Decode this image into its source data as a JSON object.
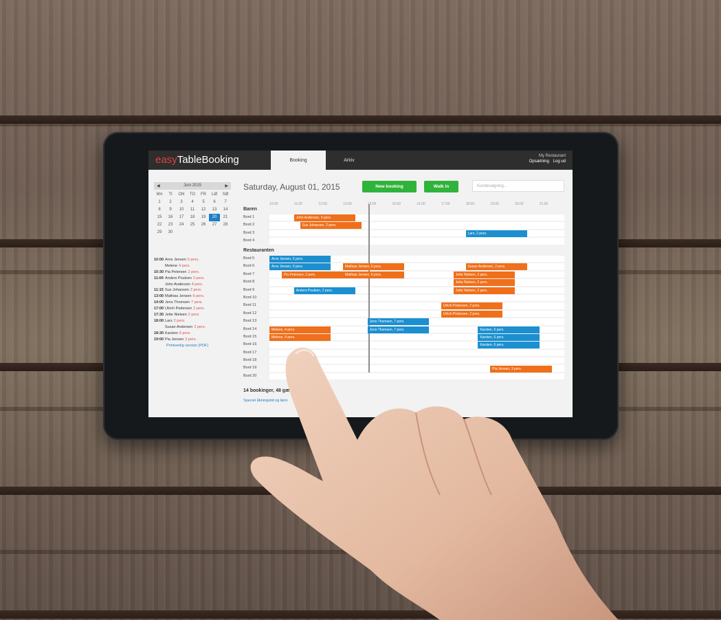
{
  "app": {
    "logo_prefix": "easy",
    "logo_main": "TableBooking",
    "tabs": [
      "Booking",
      "Arkiv"
    ],
    "restaurant_name": "My Restaurant",
    "top_links": [
      "Opsætning",
      "Log ud"
    ]
  },
  "calendar": {
    "month": "Juni 2015",
    "prev": "◀",
    "next": "▶",
    "weekdays": [
      "MA",
      "TI",
      "ON",
      "TO",
      "FR",
      "LØ",
      "SØ"
    ],
    "days": [
      "1",
      "2",
      "3",
      "4",
      "5",
      "6",
      "7",
      "8",
      "9",
      "10",
      "11",
      "12",
      "13",
      "14",
      "15",
      "16",
      "17",
      "18",
      "19",
      "20",
      "21",
      "22",
      "23",
      "24",
      "25",
      "26",
      "27",
      "28",
      "29",
      "30"
    ],
    "selected_day": "20"
  },
  "booking_list": [
    {
      "time": "10:00",
      "name": "Arne Jensen",
      "persons": "5 pers."
    },
    {
      "time": "",
      "name": "Melene",
      "persons": "4 pers."
    },
    {
      "time": "10:30",
      "name": "Pia Petersen",
      "persons": "2 pers."
    },
    {
      "time": "11:00",
      "name": "Anders Poulsen",
      "persons": "2 pers."
    },
    {
      "time": "",
      "name": "John Andersen",
      "persons": "4 pers."
    },
    {
      "time": "11:15",
      "name": "Sus Johansen",
      "persons": "2 pers."
    },
    {
      "time": "13:00",
      "name": "Mathias Jensen",
      "persons": "6 pers."
    },
    {
      "time": "14:00",
      "name": "Jens Thomsen",
      "persons": "7 pers."
    },
    {
      "time": "17:00",
      "name": "Ulrich Pedersen",
      "persons": "2 pers."
    },
    {
      "time": "17:30",
      "name": "Jette Nielsen",
      "persons": "2 pers."
    },
    {
      "time": "18:00",
      "name": "Lars",
      "persons": "2 pers."
    },
    {
      "time": "",
      "name": "Susan Andersen",
      "persons": "2 pers."
    },
    {
      "time": "18:30",
      "name": "Karsten",
      "persons": "6 pers."
    },
    {
      "time": "19:00",
      "name": "Pia Jensen",
      "persons": "3 pers."
    }
  ],
  "print_link": "Printvenlig version (PDF)",
  "main": {
    "date_title": "Saturday, August 01, 2015",
    "new_booking": "New booking",
    "walk_in": "Walk in",
    "search_placeholder": "Kundesøgning..."
  },
  "hours": [
    "10:00",
    "11:00",
    "12:00",
    "13:00",
    "14:00",
    "15:00",
    "16:00",
    "17:00",
    "18:00",
    "19:00",
    "20:00",
    "21:00"
  ],
  "sections": {
    "baren": {
      "title": "Baren",
      "tables": [
        "Bord 1",
        "Bord 2",
        "Bord 3",
        "Bord 4"
      ]
    },
    "restaurant": {
      "title": "Restauranten",
      "tables": [
        "Bord 5",
        "Bord 6",
        "Bord 7",
        "Bord 8",
        "Bord 9",
        "Bord 10",
        "Bord 11",
        "Bord 12",
        "Bord 13",
        "Bord 14",
        "Bord 15",
        "Bord 16",
        "Bord 17",
        "Bord 18",
        "Bord 19",
        "Bord 20"
      ]
    }
  },
  "bookings": [
    {
      "table": "Bord 1",
      "label": "John Andersen, 4 pers.",
      "start": 11.0,
      "end": 13.5,
      "color": "#ef6f1a"
    },
    {
      "table": "Bord 2",
      "label": "Sus Johansen, 2 pers.",
      "start": 11.25,
      "end": 13.75,
      "color": "#ef6f1a"
    },
    {
      "table": "Bord 3",
      "label": "Lars, 2 pers.",
      "start": 18.0,
      "end": 20.5,
      "color": "#1b8fd0"
    },
    {
      "table": "Bord 5",
      "label": "Arne Jensen, 5 pers.",
      "start": 10.0,
      "end": 12.5,
      "color": "#1b8fd0"
    },
    {
      "table": "Bord 6",
      "label": "Arne Jensen, 5 pers.",
      "start": 10.0,
      "end": 12.5,
      "color": "#1b8fd0"
    },
    {
      "table": "Bord 6",
      "label": "Mathias Jensen, 6 pers.",
      "start": 13.0,
      "end": 15.5,
      "color": "#ef6f1a"
    },
    {
      "table": "Bord 6",
      "label": "Susan Andersen, 2 pers.",
      "start": 18.0,
      "end": 20.5,
      "color": "#ef6f1a"
    },
    {
      "table": "Bord 7",
      "label": "Pia Petersen, 2 pers.",
      "start": 10.5,
      "end": 13.0,
      "color": "#ef6f1a"
    },
    {
      "table": "Bord 7",
      "label": "Mathias Jensen, 6 pers.",
      "start": 13.0,
      "end": 15.5,
      "color": "#ef6f1a"
    },
    {
      "table": "Bord 7",
      "label": "Jette Nielsen, 2 pers.",
      "start": 17.5,
      "end": 20.0,
      "color": "#ef6f1a"
    },
    {
      "table": "Bord 8",
      "label": "Jette Nielsen, 2 pers.",
      "start": 17.5,
      "end": 20.0,
      "color": "#ef6f1a"
    },
    {
      "table": "Bord 9",
      "label": "Anders Poulsen, 2 pers.",
      "start": 11.0,
      "end": 13.5,
      "color": "#1b8fd0"
    },
    {
      "table": "Bord 9",
      "label": "Jette Nielsen, 2 pers.",
      "start": 17.5,
      "end": 20.0,
      "color": "#ef6f1a"
    },
    {
      "table": "Bord 11",
      "label": "Ulrich Pedersen, 2 pers.",
      "start": 17.0,
      "end": 19.5,
      "color": "#ef6f1a"
    },
    {
      "table": "Bord 12",
      "label": "Ulrich Pedersen, 2 pers.",
      "start": 17.0,
      "end": 19.5,
      "color": "#ef6f1a"
    },
    {
      "table": "Bord 13",
      "label": "Jens Thomsen, 7 pers.",
      "start": 14.0,
      "end": 16.5,
      "color": "#1b8fd0"
    },
    {
      "table": "Bord 14",
      "label": "Melene, 4 pers.",
      "start": 10.0,
      "end": 12.5,
      "color": "#ef6f1a"
    },
    {
      "table": "Bord 14",
      "label": "Jens Thomsen, 7 pers.",
      "start": 14.0,
      "end": 16.5,
      "color": "#1b8fd0"
    },
    {
      "table": "Bord 14",
      "label": "Karsten, 6 pers.",
      "start": 18.5,
      "end": 21.0,
      "color": "#1b8fd0"
    },
    {
      "table": "Bord 15",
      "label": "Melene, 4 pers.",
      "start": 10.0,
      "end": 12.5,
      "color": "#ef6f1a"
    },
    {
      "table": "Bord 15",
      "label": "Karsten, 6 pers.",
      "start": 18.5,
      "end": 21.0,
      "color": "#1b8fd0"
    },
    {
      "table": "Bord 16",
      "label": "Karsten, 6 pers.",
      "start": 18.5,
      "end": 21.0,
      "color": "#1b8fd0"
    },
    {
      "table": "Bord 19",
      "label": "Pia Jensen, 3 pers.",
      "start": 19.0,
      "end": 21.5,
      "color": "#ef6f1a"
    }
  ],
  "summary": "14 bookinger, 48 gæ",
  "summary_link": "Speciel åbningstid og lønn"
}
